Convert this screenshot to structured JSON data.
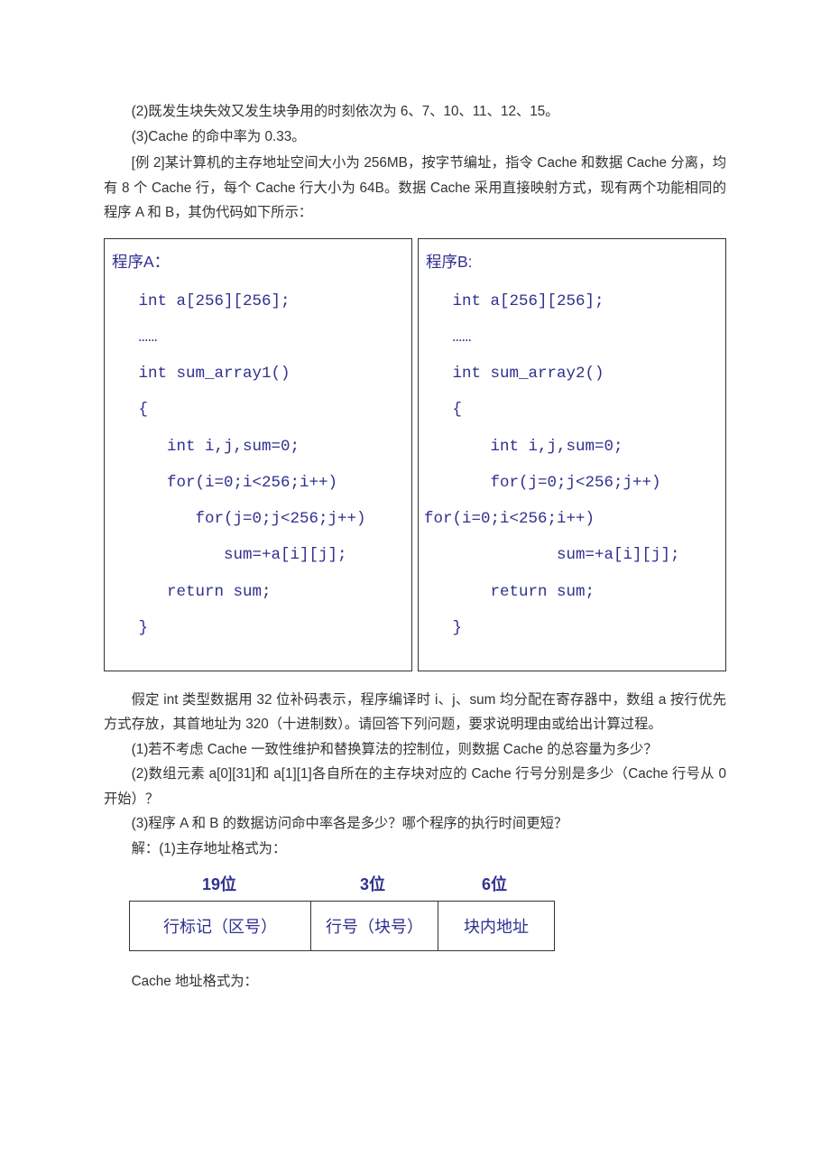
{
  "body": {
    "p1": "(2)既发生块失效又发生块争用的时刻依次为 6、7、10、11、12、15。",
    "p2": "(3)Cache 的命中率为 0.33。",
    "p3": "[例 2]某计算机的主存地址空间大小为 256MB，按字节编址，指令 Cache 和数据 Cache 分离，均有 8 个 Cache 行，每个 Cache 行大小为 64B。数据 Cache 采用直接映射方式，现有两个功能相同的程序 A 和 B，其伪代码如下所示："
  },
  "progA": {
    "title": "程序A：",
    "lines": [
      "   int a[256][256];",
      "   ……",
      "   int sum_array1()",
      "   {",
      "      int i,j,sum=0;",
      "      for(i=0;i<256;i++)",
      "         for(j=0;j<256;j++)",
      "            sum=+a[i][j];",
      "      return sum;",
      "   }"
    ]
  },
  "progB": {
    "title": "程序B:",
    "lines": [
      "   int a[256][256];",
      "   ……",
      "   int sum_array2()",
      "   {",
      "       int i,j,sum=0;",
      "       for(j=0;j<256;j++)",
      "",
      "for(i=0;i<256;i++)",
      "              sum=+a[i][j];",
      "       return sum;",
      "   }"
    ]
  },
  "body2": {
    "p4": "假定 int 类型数据用 32 位补码表示，程序编译时 i、j、sum 均分配在寄存器中，数组 a 按行优先方式存放，其首地址为 320（十进制数）。请回答下列问题，要求说明理由或给出计算过程。",
    "p5": "(1)若不考虑 Cache 一致性维护和替换算法的控制位，则数据 Cache 的总容量为多少？",
    "p6": "(2)数组元素 a[0][31]和 a[1][1]各自所在的主存块对应的 Cache 行号分别是多少（Cache 行号从 0 开始）？",
    "p7": "(3)程序 A 和 B 的数据访问命中率各是多少？哪个程序的执行时间更短？",
    "p8": "解：(1)主存地址格式为："
  },
  "addr": {
    "h1": "19位",
    "h2": "3位",
    "h3": "6位",
    "c1": "行标记（区号）",
    "c2": "行号（块号）",
    "c3": "块内地址"
  },
  "foot": {
    "p9": "Cache 地址格式为："
  }
}
